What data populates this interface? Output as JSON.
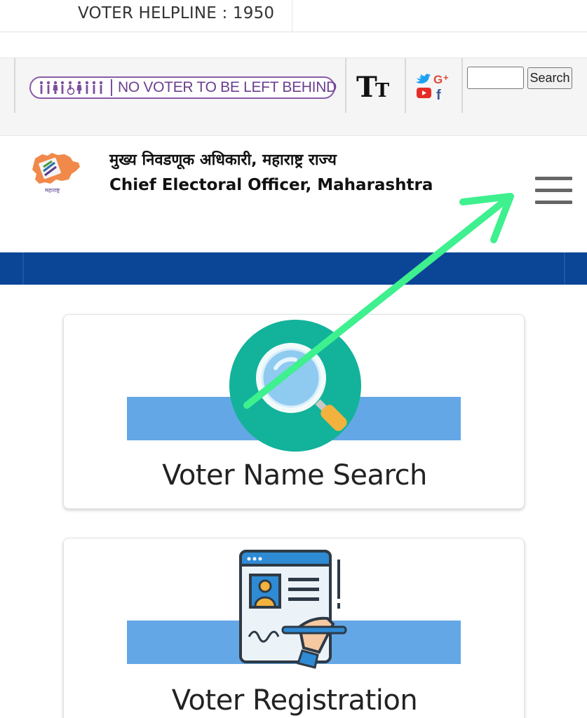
{
  "helpline": {
    "text": "VOTER HELPLINE : 1950"
  },
  "toolbar": {
    "badge_text": "NO VOTER TO BE LEFT BEHIND",
    "textsize_big": "T",
    "textsize_small": "T",
    "search_placeholder": "",
    "search_button": "Search"
  },
  "header": {
    "title_marathi": "मुख्य निवडणूक अधिकारी, महाराष्ट्र राज्य",
    "title_english": "Chief Electoral Officer, Maharashtra",
    "logo_caption": "महाराष्ट्र"
  },
  "cards": [
    {
      "label": "Voter Name Search",
      "icon": "magnifier-icon"
    },
    {
      "label": "Voter Registration",
      "icon": "registration-form-icon"
    }
  ],
  "colors": {
    "nav_band": "#0b4596",
    "card_stripe": "#64a7e6",
    "arrow": "#3ef08e",
    "badge": "#6a3f8f"
  }
}
